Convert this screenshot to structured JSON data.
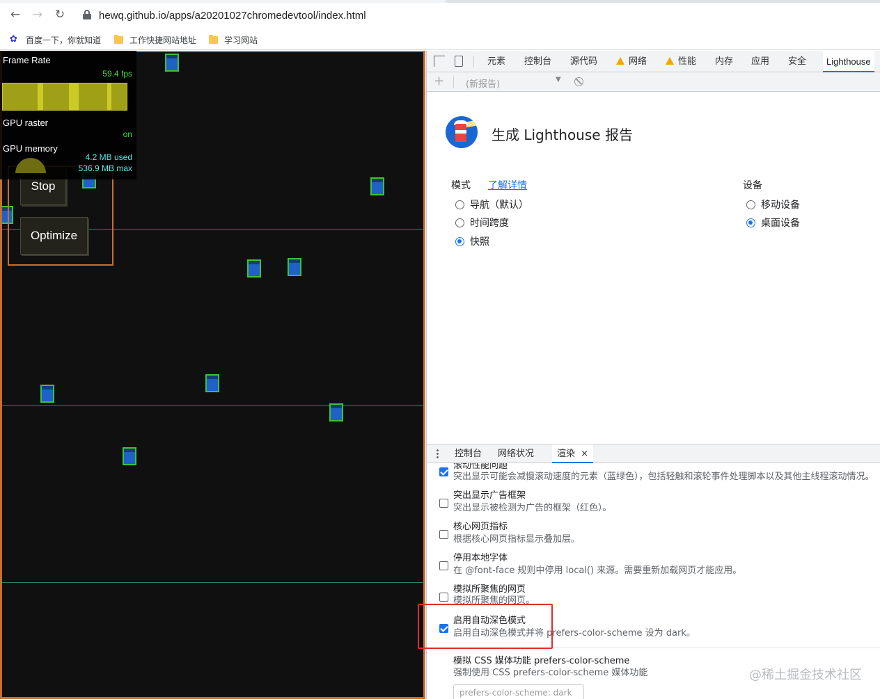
{
  "browser": {
    "url": "hewq.github.io/apps/a20201027chromedevtool/index.html",
    "nav": {
      "back": "←",
      "forward": "→",
      "reload": "↻"
    },
    "bookmarks": [
      {
        "label": "百度一下，你就知道",
        "icon": "baidu-paw-icon"
      },
      {
        "label": "工作快捷网站地址",
        "icon": "folder-icon"
      },
      {
        "label": "学习网站",
        "icon": "folder-icon"
      }
    ]
  },
  "hud": {
    "frame_rate_label": "Frame Rate",
    "fps": "59.4 fps",
    "gpu_raster_label": "GPU raster",
    "gpu_raster_value": "on",
    "gpu_memory_label": "GPU memory",
    "memory_used": "4.2 MB used",
    "memory_max": "536.9 MB max"
  },
  "page_buttons": {
    "stop": "Stop",
    "optimize": "Optimize"
  },
  "devtools": {
    "tabs": [
      "元素",
      "控制台",
      "源代码",
      "网络",
      "性能",
      "内存",
      "应用",
      "安全",
      "Lighthouse"
    ],
    "report_select": "(新报告)",
    "lighthouse": {
      "title": "生成 Lighthouse 报告",
      "mode_label": "模式",
      "learn_more": "了解详情",
      "modes": [
        {
          "label": "导航（默认）",
          "selected": false
        },
        {
          "label": "时间跨度",
          "selected": false
        },
        {
          "label": "快照",
          "selected": true
        }
      ],
      "device_label": "设备",
      "devices": [
        {
          "label": "移动设备",
          "selected": false
        },
        {
          "label": "桌面设备",
          "selected": true
        }
      ]
    },
    "drawer": {
      "tabs": [
        "控制台",
        "网络状况",
        "渲染"
      ],
      "close": "×",
      "options": [
        {
          "title": "滚动性能问题",
          "desc": "突出显示可能会减慢滚动速度的元素（蓝绿色），包括轻触和滚轮事件处理脚本以及其他主线程滚动情况。",
          "checked": true
        },
        {
          "title": "突出显示广告框架",
          "desc": "突出显示被检测为广告的框架（红色）。",
          "checked": false
        },
        {
          "title": "核心网页指标",
          "desc": "根据核心网页指标显示叠加层。",
          "checked": false
        },
        {
          "title": "停用本地字体",
          "desc": "在 @font-face 规则中停用 local() 来源。需要重新加载网页才能应用。",
          "checked": false
        },
        {
          "title": "模拟所聚焦的网页",
          "desc": "模拟所聚焦的网页。",
          "checked": false
        },
        {
          "title": "启用自动深色模式",
          "desc": "启用自动深色模式并将 prefers-color-scheme 设为 dark。",
          "checked": true
        }
      ],
      "emulate_title": "模拟 CSS 媒体功能 prefers-color-scheme",
      "emulate_desc": "强制使用 CSS prefers-color-scheme 媒体功能",
      "emulate_select": "prefers-color-scheme: dark"
    }
  },
  "watermark": "@稀土掘金技术社区",
  "colors": {
    "accent": "#1a73e8",
    "highlight_border": "#e52b2b",
    "page_border": "#c8702a",
    "square_border": "#3ac33c",
    "square_fill": "#2061c8"
  }
}
